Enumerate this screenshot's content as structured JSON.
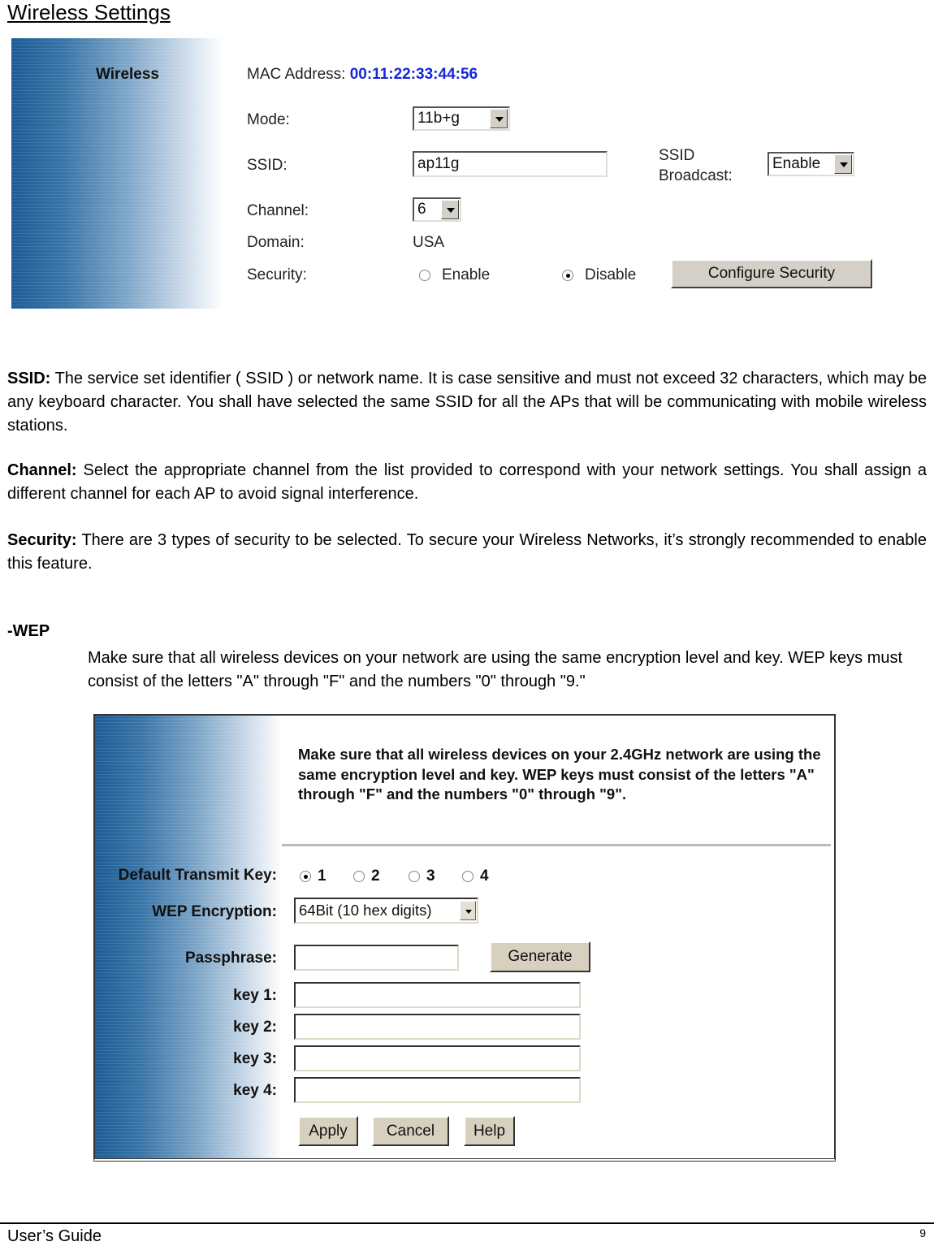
{
  "page": {
    "title": "Wireless Settings",
    "footer_left": "User’s Guide",
    "page_number": "9"
  },
  "wireless_panel": {
    "section_title": "Wireless",
    "mac_label": "MAC Address:",
    "mac_value": "00:11:22:33:44:56",
    "mode_label": "Mode:",
    "mode_value": "11b+g",
    "ssid_label": "SSID:",
    "ssid_value": "ap11g",
    "ssid_broadcast_label_1": "SSID",
    "ssid_broadcast_label_2": "Broadcast:",
    "ssid_broadcast_value": "Enable",
    "channel_label": "Channel:",
    "channel_value": "6",
    "domain_label": "Domain:",
    "domain_value": "USA",
    "security_label": "Security:",
    "security_options": [
      {
        "label": "Enable",
        "selected": false
      },
      {
        "label": "Disable",
        "selected": true
      }
    ],
    "configure_button": "Configure Security"
  },
  "paragraphs": {
    "ssid_term": "SSID:",
    "ssid_text": " The service set identifier ( SSID ) or network name. It is case sensitive and must not exceed 32 characters, which may be any keyboard character. You shall have selected the same SSID for all the APs that will be communicating with mobile wireless stations.",
    "channel_term": "Channel:",
    "channel_text": " Select the appropriate channel from the list provided to correspond with your network settings. You shall assign a different channel for each AP to avoid signal interference.",
    "security_term": "Security:",
    "security_text": " There are 3 types of security to be selected. To secure your Wireless Networks, it’s strongly recommended to enable this feature.",
    "wep_heading": "-WEP",
    "wep_text": "Make sure that all wireless devices on your network are using the same encryption level and key. WEP keys must consist of the letters \"A\" through \"F\" and the numbers \"0\" through \"9.\""
  },
  "wep_panel": {
    "intro": "Make sure that all wireless devices on your 2.4GHz network are using the same encryption level and key. WEP keys must consist of the letters \"A\" through \"F\" and the numbers \"0\" through \"9\".",
    "default_key_label": "Default Transmit Key:",
    "default_key_options": [
      {
        "label": "1",
        "selected": true
      },
      {
        "label": "2",
        "selected": false
      },
      {
        "label": "3",
        "selected": false
      },
      {
        "label": "4",
        "selected": false
      }
    ],
    "encryption_label": "WEP Encryption:",
    "encryption_value": "64Bit (10 hex digits)",
    "passphrase_label": "Passphrase:",
    "passphrase_value": "",
    "generate_button": "Generate",
    "keys": [
      {
        "label": "key 1:",
        "value": ""
      },
      {
        "label": "key 2:",
        "value": ""
      },
      {
        "label": "key 3:",
        "value": ""
      },
      {
        "label": "key 4:",
        "value": ""
      }
    ],
    "apply_button": "Apply",
    "cancel_button": "Cancel",
    "help_button": "Help"
  }
}
